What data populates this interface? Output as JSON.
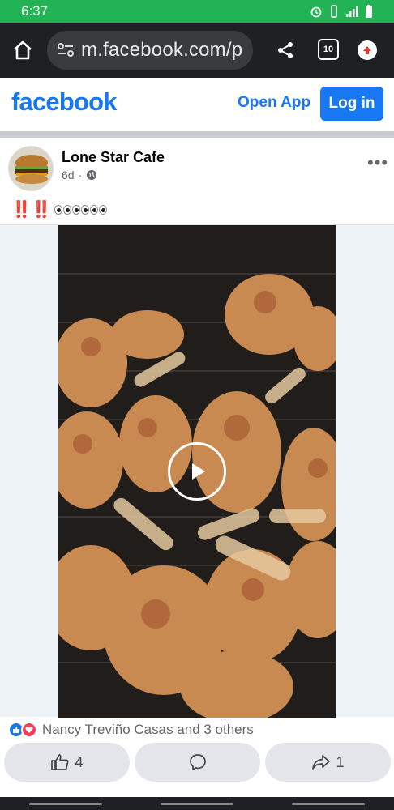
{
  "status_bar": {
    "time": "6:37"
  },
  "browser": {
    "url": "m.facebook.com/p",
    "tab_count": "10"
  },
  "fb_header": {
    "logo": "facebook",
    "open_app": "Open App",
    "login": "Log in"
  },
  "post": {
    "page_name": "Lone Star Cafe",
    "age": "6d",
    "separator": "·",
    "text_emoji": "‼️‼️",
    "reactions_text": "Nancy Treviño Casas and 3 others",
    "like_count": "4",
    "share_count": "1"
  },
  "colors": {
    "brand": "#1877f2",
    "status_bar": "#22b454",
    "browser_bar": "#1f2023"
  },
  "icons": [
    "home-icon",
    "site-settings-icon",
    "share-icon",
    "tabs-icon",
    "update-icon",
    "globe-icon",
    "more-icon",
    "play-icon",
    "like-icon",
    "comment-icon",
    "share-arrow-icon"
  ]
}
